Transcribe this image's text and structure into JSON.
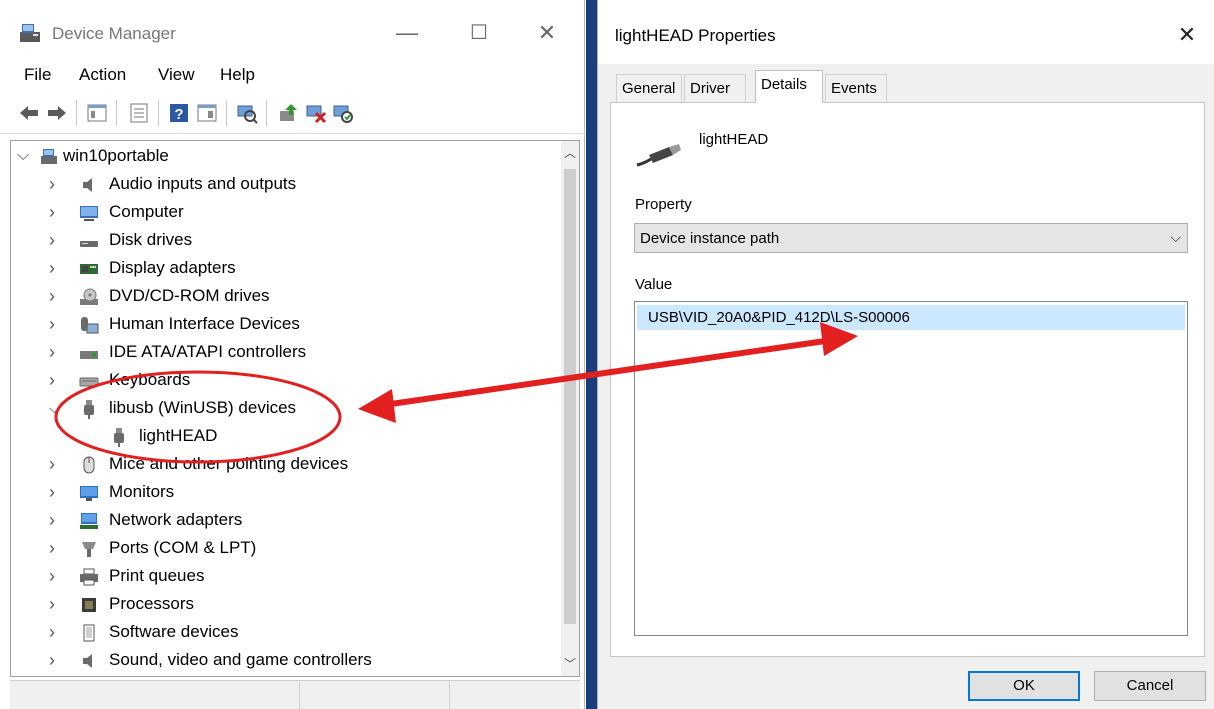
{
  "device_manager": {
    "title": "Device Manager",
    "controls": {
      "minimize": "—",
      "maximize": "☐",
      "close": "✕"
    },
    "menu": [
      "File",
      "Action",
      "View",
      "Help"
    ],
    "toolbar_icons": [
      "back-icon",
      "forward-icon",
      "show-hide-tree-icon",
      "properties-icon",
      "help-icon",
      "view-icon",
      "scan-hardware-icon",
      "update-driver-icon",
      "uninstall-device-icon",
      "enable-device-icon"
    ],
    "tree": {
      "root": "win10portable",
      "categories": [
        {
          "label": "Audio inputs and outputs",
          "icon": "speaker-icon"
        },
        {
          "label": "Computer",
          "icon": "computer-icon"
        },
        {
          "label": "Disk drives",
          "icon": "disk-drive-icon"
        },
        {
          "label": "Display adapters",
          "icon": "display-adapter-icon"
        },
        {
          "label": "DVD/CD-ROM drives",
          "icon": "dvd-drive-icon"
        },
        {
          "label": "Human Interface Devices",
          "icon": "hid-icon"
        },
        {
          "label": "IDE ATA/ATAPI controllers",
          "icon": "ide-controller-icon"
        },
        {
          "label": "Keyboards",
          "icon": "keyboard-icon"
        },
        {
          "label": "libusb (WinUSB) devices",
          "icon": "usb-plug-icon",
          "expanded": true
        },
        {
          "label": "lightHEAD",
          "icon": "usb-plug-icon",
          "child": true
        },
        {
          "label": "Mice and other pointing devices",
          "icon": "mouse-icon"
        },
        {
          "label": "Monitors",
          "icon": "monitor-icon"
        },
        {
          "label": "Network adapters",
          "icon": "network-adapter-icon"
        },
        {
          "label": "Ports (COM & LPT)",
          "icon": "port-icon"
        },
        {
          "label": "Print queues",
          "icon": "printer-icon"
        },
        {
          "label": "Processors",
          "icon": "processor-icon"
        },
        {
          "label": "Software devices",
          "icon": "software-device-icon"
        },
        {
          "label": "Sound, video and game controllers",
          "icon": "speaker-icon"
        }
      ]
    }
  },
  "properties": {
    "title": "lightHEAD Properties",
    "close": "✕",
    "tabs": [
      "General",
      "Driver",
      "Details",
      "Events"
    ],
    "active_tab": "Details",
    "device_name": "lightHEAD",
    "property_label": "Property",
    "property_value": "Device instance path",
    "value_label": "Value",
    "value": "USB\\VID_20A0&PID_412D\\LS-S00006",
    "ok": "OK",
    "cancel": "Cancel"
  },
  "colors": {
    "annotation": "#e32020",
    "selection": "#cce8ff",
    "desktop": "#1a3d7c",
    "default_button_border": "#0078d7"
  }
}
